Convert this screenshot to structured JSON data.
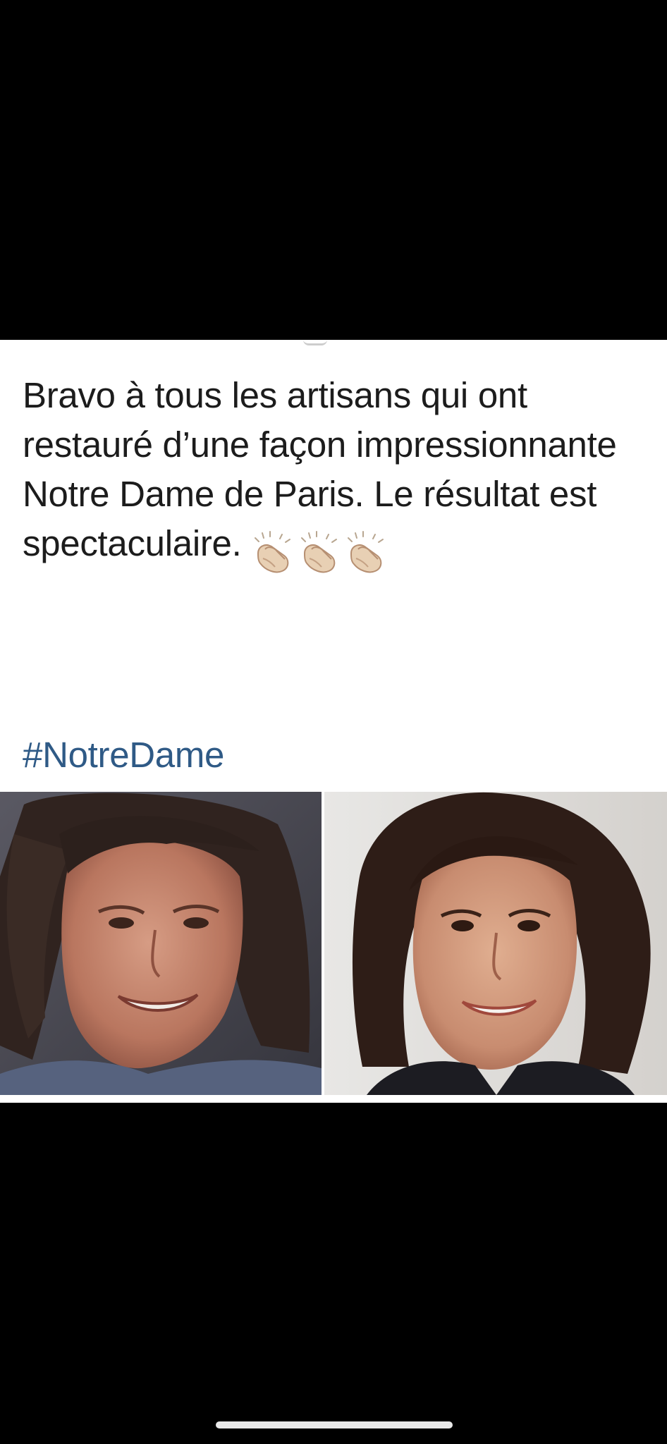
{
  "post": {
    "text": "Bravo à tous les artisans qui ont restauré d’une façon impressionnante Notre Dame de Paris. Le résultat est spectaculaire.",
    "reaction_emoji": "clapping-hands-icon",
    "reaction_count_shown": 3,
    "hashtag": "#NotreDame"
  },
  "photos": [
    {
      "name": "left-photo",
      "subject": "woman-with-tousled-dark-hair"
    },
    {
      "name": "right-photo",
      "subject": "woman-with-styled-dark-bob"
    }
  ],
  "colors": {
    "background": "#000000",
    "card": "#ffffff",
    "text": "#1c1c1c",
    "hashtag": "#2f5a86",
    "home_indicator": "#e9e9e9"
  }
}
